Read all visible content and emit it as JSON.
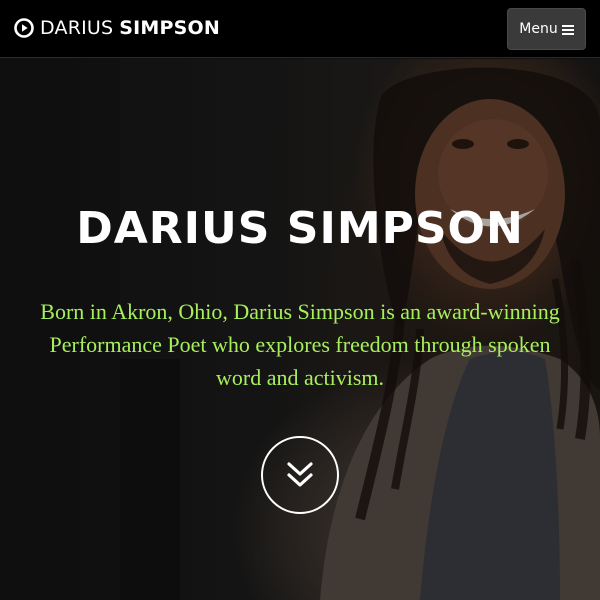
{
  "navbar": {
    "brand": {
      "icon": "play-circle-icon",
      "first_name": "DARIUS",
      "last_name": "SIMPSON"
    },
    "menu_button": {
      "label": "Menu",
      "icon": "bars-icon"
    }
  },
  "hero": {
    "title": "DARIUS SIMPSON",
    "intro": "Born in Akron, Ohio, Darius Simpson is an award-winning Performance Poet who explores freedom through spoken word and activism.",
    "scroll_button": {
      "icon": "double-chevron-down-icon"
    }
  },
  "colors": {
    "navbar_background": "#000000",
    "menu_button_background": "#3a3a3a",
    "title_text": "#ffffff",
    "intro_text": "#a8ef5c"
  }
}
